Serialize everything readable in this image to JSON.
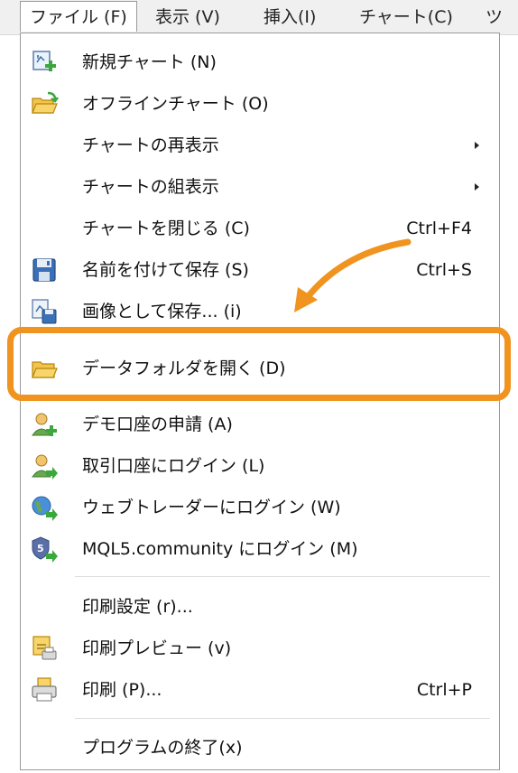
{
  "menubar": {
    "items": [
      {
        "label": "ファイル (F)"
      },
      {
        "label": "表示 (V)"
      },
      {
        "label": "挿入(I)"
      },
      {
        "label": "チャート(C)"
      },
      {
        "label": "ツ"
      }
    ]
  },
  "menu": {
    "items": [
      {
        "label": "新規チャート (N)",
        "shortcut": "",
        "icon": "new-chart-icon"
      },
      {
        "label": "オフラインチャート (O)",
        "shortcut": "",
        "icon": "open-folder-icon"
      },
      {
        "label": "チャートの再表示",
        "shortcut": "",
        "icon": "none"
      },
      {
        "label": "チャートの組表示",
        "shortcut": "",
        "icon": "none"
      },
      {
        "label": "チャートを閉じる (C)",
        "shortcut": "Ctrl+F4",
        "icon": "none"
      },
      {
        "label": "名前を付けて保存 (S)",
        "shortcut": "Ctrl+S",
        "icon": "save-icon"
      },
      {
        "label": "画像として保存... (i)",
        "shortcut": "",
        "icon": "save-image-icon"
      },
      {
        "label": "データフォルダを開く (D)",
        "shortcut": "",
        "icon": "folder-icon"
      },
      {
        "label": "デモ口座の申請 (A)",
        "shortcut": "",
        "icon": "demo-account-icon"
      },
      {
        "label": "取引口座にログイン (L)",
        "shortcut": "",
        "icon": "login-account-icon"
      },
      {
        "label": "ウェブトレーダーにログイン (W)",
        "shortcut": "",
        "icon": "web-trader-icon"
      },
      {
        "label": "MQL5.community にログイン (M)",
        "shortcut": "",
        "icon": "mql5-community-icon"
      },
      {
        "label": "印刷設定 (r)...",
        "shortcut": "",
        "icon": "none"
      },
      {
        "label": "印刷プレビュー (v)",
        "shortcut": "",
        "icon": "print-preview-icon"
      },
      {
        "label": "印刷 (P)...",
        "shortcut": "Ctrl+P",
        "icon": "printer-icon"
      },
      {
        "label": "プログラムの終了(x)",
        "shortcut": "",
        "icon": "none"
      }
    ]
  },
  "colors": {
    "highlight": "#f0931f",
    "menubar_bg": "#f0f0f0",
    "menu_bg": "#ffffff"
  }
}
